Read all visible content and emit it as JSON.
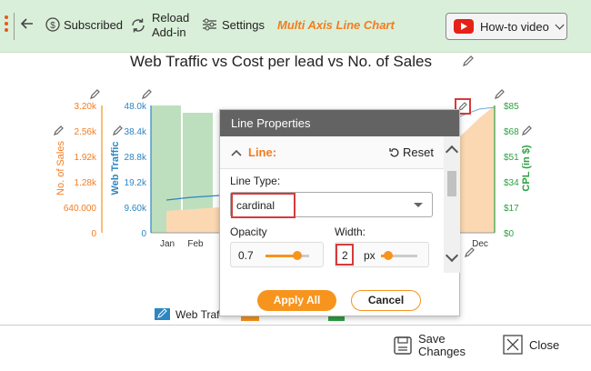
{
  "toolbar": {
    "subscribed": "Subscribed",
    "reload_line1": "Reload",
    "reload_line2": "Add-in",
    "settings": "Settings",
    "chart_name": "Multi Axis Line Chart",
    "howto": "How-to video"
  },
  "chart_data": {
    "type": "bar",
    "title": "Web Traffic vs Cost per lead vs No. of Sales",
    "categories": [
      "Jan",
      "Feb",
      "Dec"
    ],
    "left_axis_outer": {
      "label": "No. of Sales",
      "ticks": [
        "3.20k",
        "2.56k",
        "1.92k",
        "1.28k",
        "640.000",
        "0"
      ]
    },
    "left_axis_inner": {
      "label": "Web Traffic",
      "ticks": [
        "48.0k",
        "38.4k",
        "28.8k",
        "19.2k",
        "9.60k",
        "0"
      ]
    },
    "right_axis": {
      "label": "CPL (in $)",
      "ticks": [
        "$85",
        "$68",
        "$51",
        "$34",
        "$17",
        "$0"
      ]
    },
    "bars": [
      48000,
      46000
    ],
    "legend": [
      "Web Traf"
    ]
  },
  "colors": {
    "sales": "#f7941d",
    "traffic": "#2e86c1",
    "cpl": "#2ea043",
    "accent": "#f47c20",
    "highlight": "#d63b3b"
  },
  "dialog": {
    "title": "Line Properties",
    "section": "Line:",
    "reset": "Reset",
    "line_type_label": "Line Type:",
    "line_type_value": "cardinal",
    "opacity_label": "Opacity",
    "opacity_value": "0.7",
    "width_label": "Width:",
    "width_value": "2",
    "width_unit": "px",
    "apply": "Apply All",
    "cancel": "Cancel"
  },
  "bottom": {
    "save_line1": "Save",
    "save_line2": "Changes",
    "close": "Close"
  }
}
